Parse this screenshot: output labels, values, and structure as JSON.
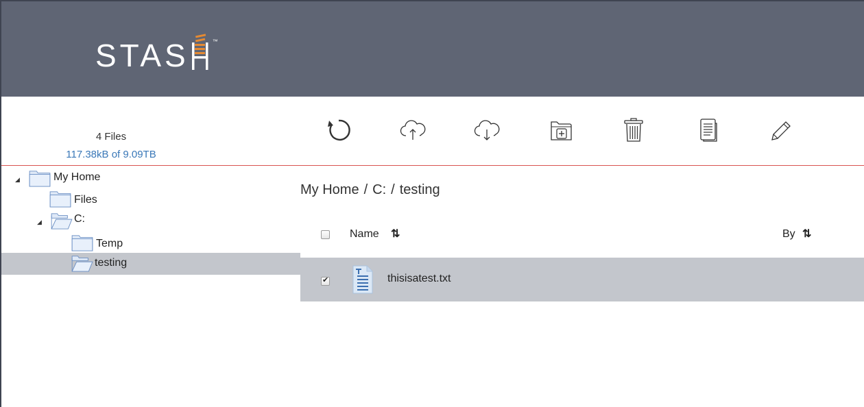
{
  "app": {
    "logo_text": "STAS",
    "logo_tm": "™",
    "brand_color": "#5f6574",
    "accent_color": "#e58a32"
  },
  "stats": {
    "file_count": "4 Files",
    "storage": "117.38kB of 9.09TB"
  },
  "toolbar": {
    "items": [
      {
        "name": "refresh",
        "icon": "refresh-icon"
      },
      {
        "name": "upload",
        "icon": "cloud-upload-icon"
      },
      {
        "name": "download",
        "icon": "cloud-download-icon"
      },
      {
        "name": "new-folder",
        "icon": "folder-plus-icon"
      },
      {
        "name": "delete",
        "icon": "trash-icon"
      },
      {
        "name": "copy",
        "icon": "copy-icon"
      },
      {
        "name": "rename",
        "icon": "pencil-icon"
      }
    ]
  },
  "tree": {
    "items": [
      {
        "label": "My Home",
        "expanded": true,
        "has_toggle": true,
        "open_folder": false
      },
      {
        "label": "Files",
        "expanded": false,
        "has_toggle": false,
        "open_folder": false
      },
      {
        "label": "C:",
        "expanded": true,
        "has_toggle": true,
        "open_folder": true
      },
      {
        "label": "Temp",
        "expanded": false,
        "has_toggle": false,
        "open_folder": false
      },
      {
        "label": "testing",
        "expanded": false,
        "has_toggle": false,
        "open_folder": true,
        "selected": true
      }
    ],
    "toggle_glyph": "◢"
  },
  "breadcrumb": {
    "parts": [
      "My Home",
      "C:",
      "testing"
    ],
    "separator": "/"
  },
  "table": {
    "columns": {
      "name": "Name",
      "by": "By",
      "sort_glyph": "⇅"
    },
    "rows": [
      {
        "name": "thisisatest.txt",
        "checked": true,
        "icon": "text-file-icon"
      }
    ]
  }
}
